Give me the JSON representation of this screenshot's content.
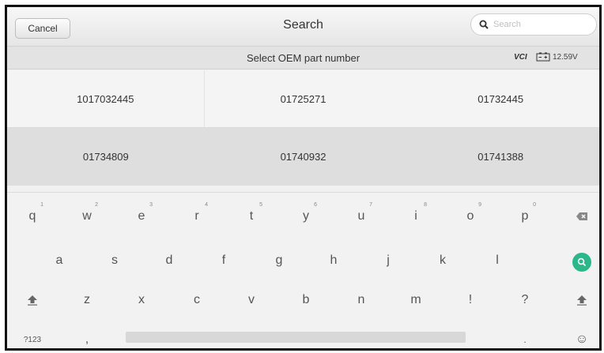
{
  "header": {
    "cancel_label": "Cancel",
    "title": "Search",
    "search_placeholder": "Search"
  },
  "subheader": {
    "title": "Select OEM part number",
    "vci_label": "VCI",
    "voltage": "12.59V"
  },
  "parts": [
    [
      "1017032445",
      "01725271",
      "01732445"
    ],
    [
      "01734809",
      "01740932",
      "01741388"
    ]
  ],
  "keyboard": {
    "row1": [
      {
        "k": "q",
        "n": "1"
      },
      {
        "k": "w",
        "n": "2"
      },
      {
        "k": "e",
        "n": "3"
      },
      {
        "k": "r",
        "n": "4"
      },
      {
        "k": "t",
        "n": "5"
      },
      {
        "k": "y",
        "n": "6"
      },
      {
        "k": "u",
        "n": "7"
      },
      {
        "k": "i",
        "n": "8"
      },
      {
        "k": "o",
        "n": "9"
      },
      {
        "k": "p",
        "n": "0"
      }
    ],
    "row2": [
      "a",
      "s",
      "d",
      "f",
      "g",
      "h",
      "j",
      "k",
      "l"
    ],
    "row3": [
      "z",
      "x",
      "c",
      "v",
      "b",
      "n",
      "m",
      "!",
      "?"
    ],
    "symbols_label": "?123",
    "comma": ",",
    "period": ".",
    "emoji": "☺"
  },
  "colors": {
    "accent": "#2cb78b"
  }
}
